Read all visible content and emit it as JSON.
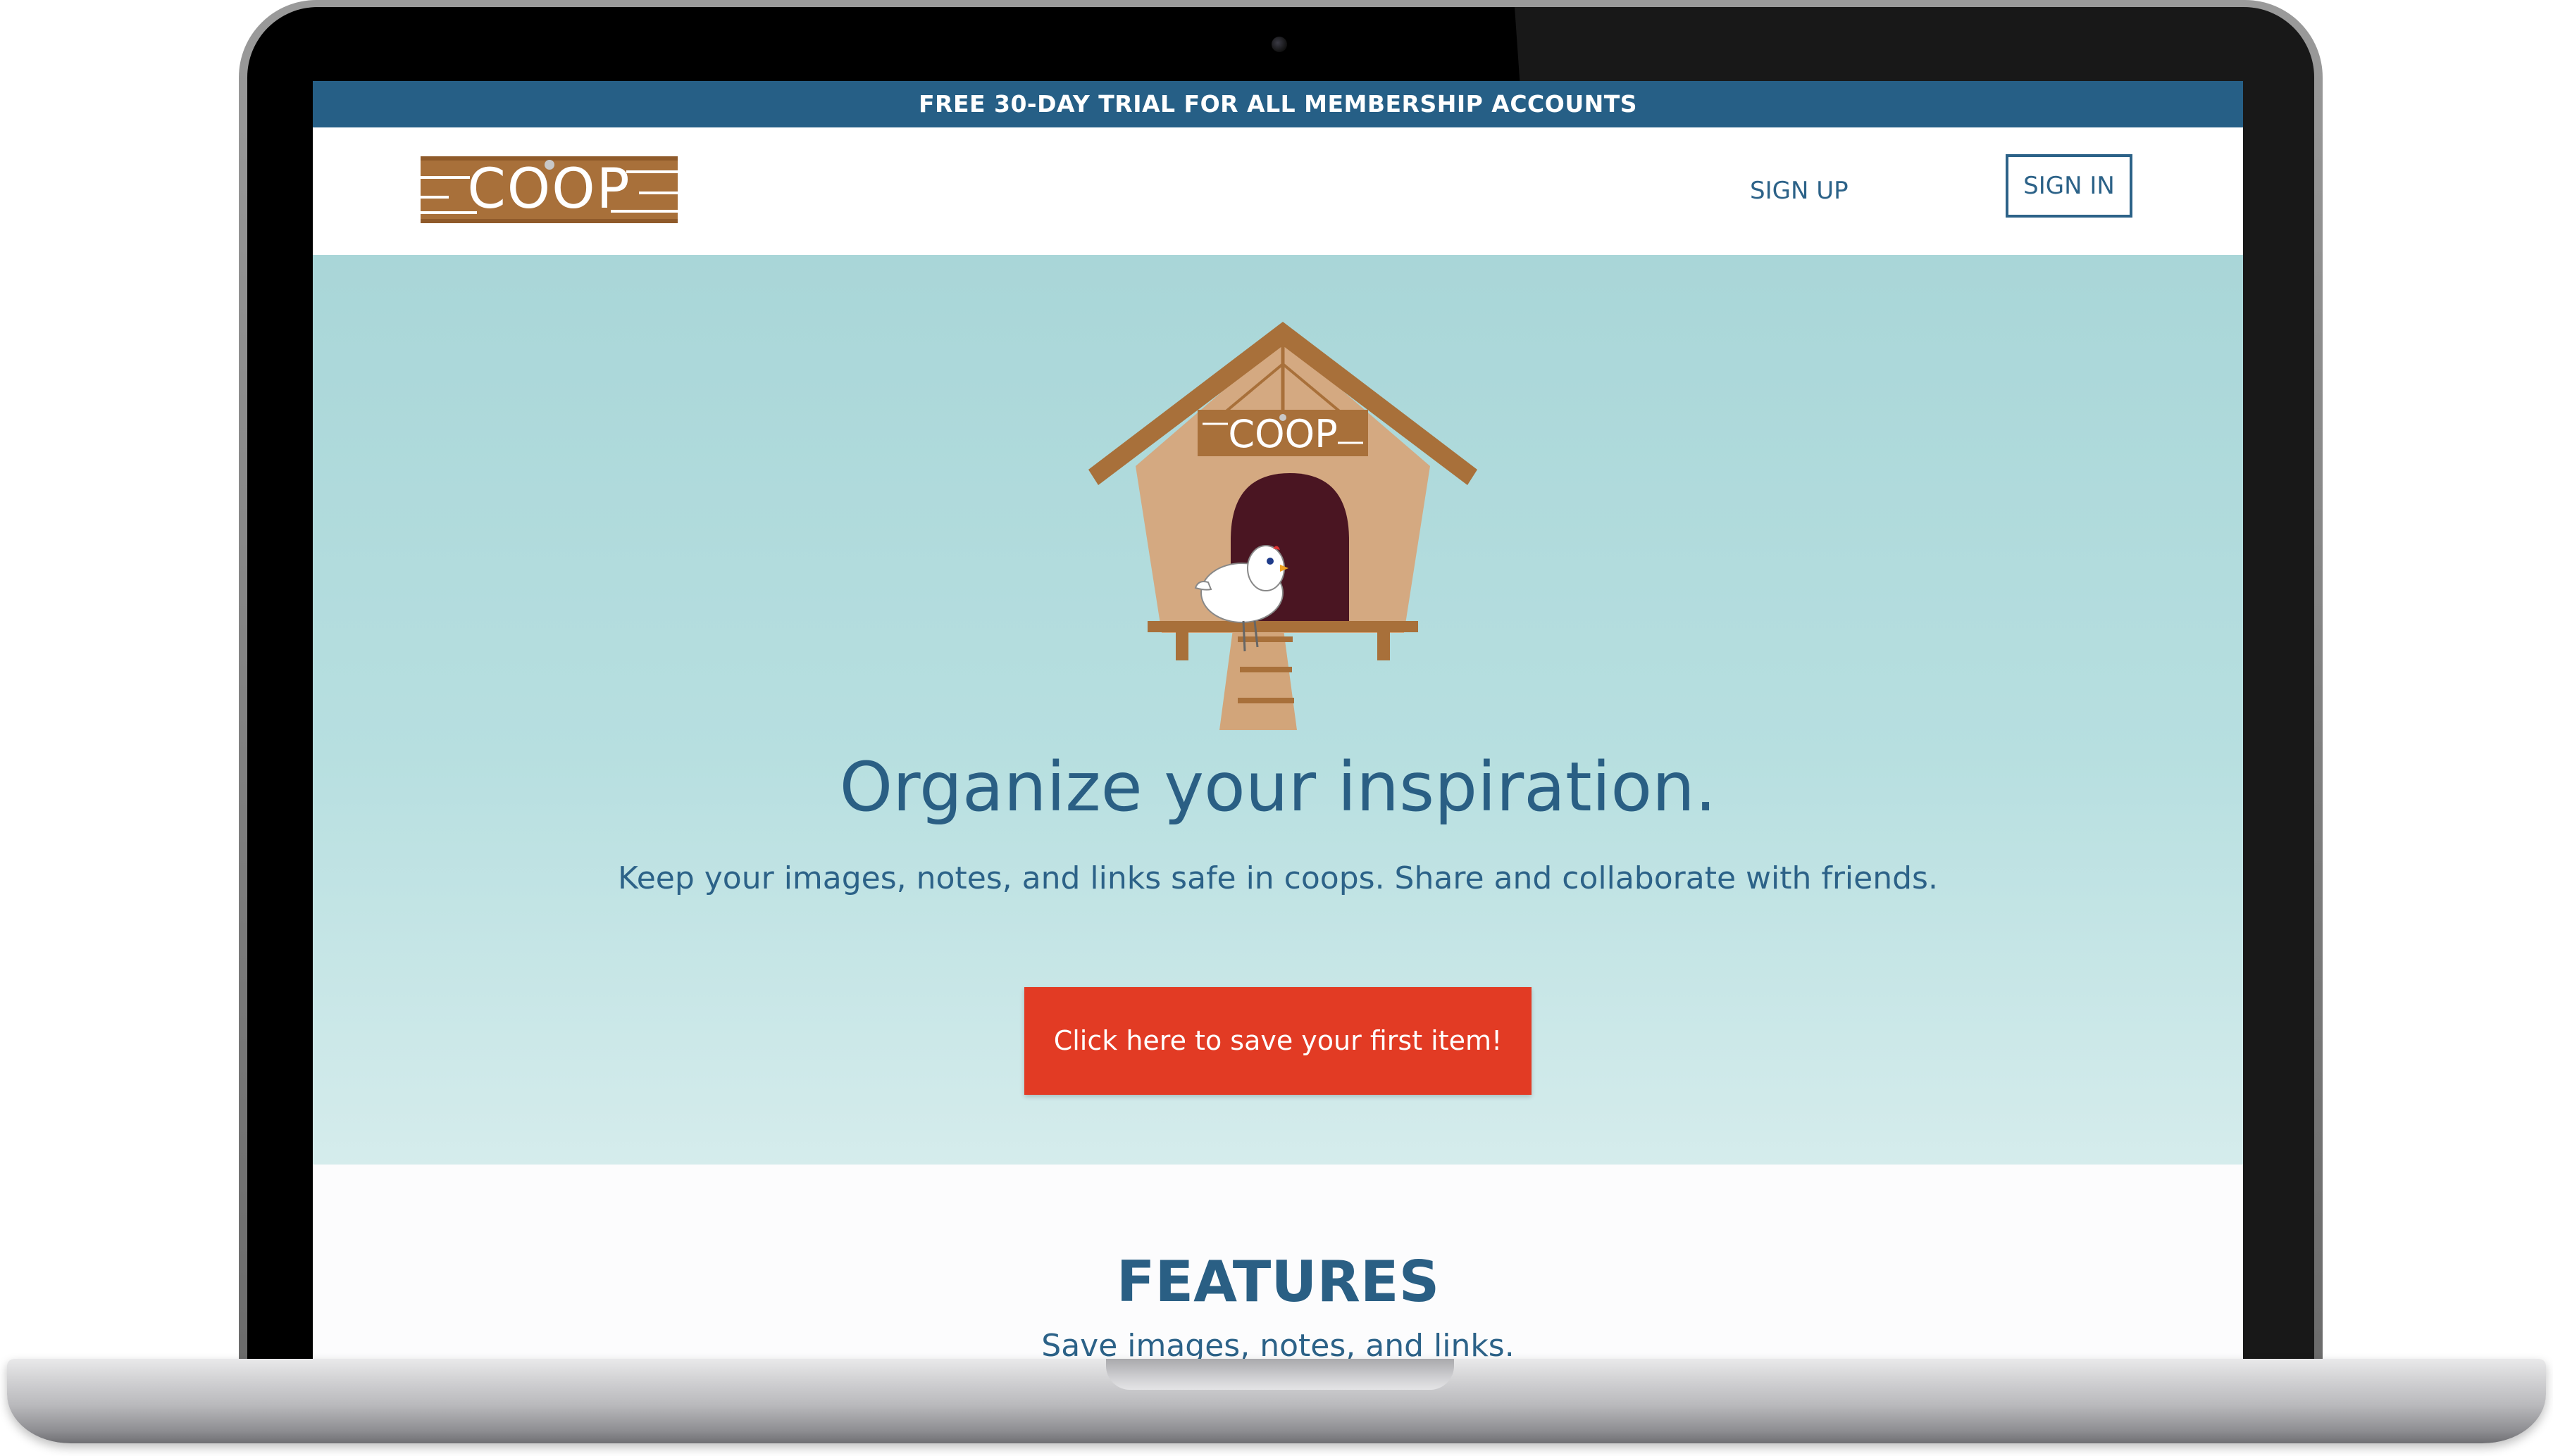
{
  "promo_bar": {
    "text": "FREE 30-DAY TRIAL FOR ALL MEMBERSHIP ACCOUNTS"
  },
  "header": {
    "logo_text": "COOP",
    "nav": {
      "sign_up": "SIGN UP",
      "sign_in": "SIGN IN"
    }
  },
  "hero": {
    "illustration_sign": "COOP",
    "title": "Organize your inspiration.",
    "subtitle": "Keep your images, notes, and links safe in coops. Share and collaborate with friends.",
    "cta_label": "Click here to save your first item!"
  },
  "features": {
    "title": "FEATURES",
    "subtitle": "Save images, notes, and links."
  },
  "colors": {
    "promo_bar": "#265f86",
    "brand_text": "#2c6288",
    "hero_bg_top": "#a9d6d8",
    "hero_bg_bottom": "#d5ecec",
    "cta": "#e23b24",
    "wood": "#a8703a",
    "coop_body": "#d4a981",
    "door": "#4a1522"
  }
}
